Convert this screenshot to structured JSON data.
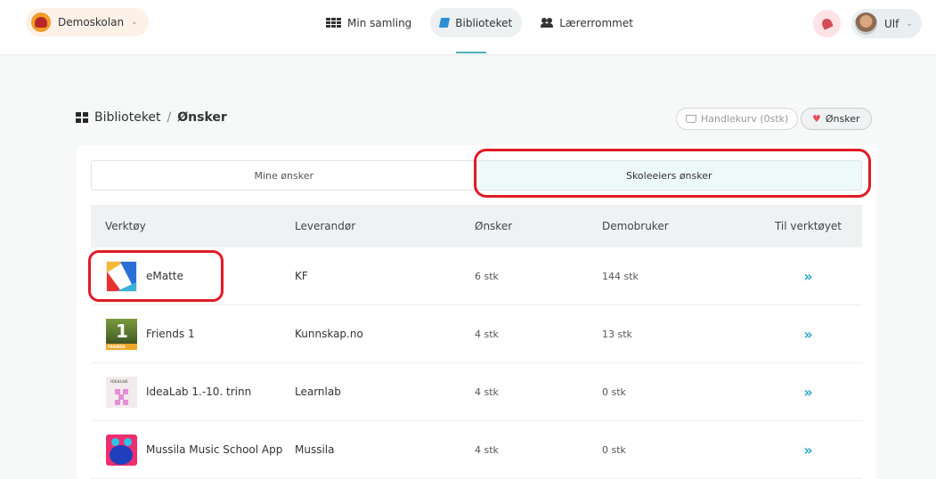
{
  "header": {
    "school_name": "Demoskolan",
    "nav": [
      {
        "label": "Min samling",
        "icon": "grid-icon"
      },
      {
        "label": "Biblioteket",
        "icon": "book-icon",
        "active": true
      },
      {
        "label": "Lærerrommet",
        "icon": "users-icon"
      }
    ],
    "user_name": "Ulf"
  },
  "breadcrumb": {
    "root": "Biblioteket",
    "separator": "/",
    "current": "Ønsker"
  },
  "actions": {
    "cart_label": "Handlekurv (0stk)",
    "wishes_label": "Ønsker"
  },
  "tabs": [
    {
      "label": "Mine ønsker",
      "active": false
    },
    {
      "label": "Skoleeiers ønsker",
      "active": true
    }
  ],
  "table": {
    "columns": [
      "Verktøy",
      "Leverandør",
      "Ønsker",
      "Demobruker",
      "Til verktøyet"
    ],
    "rows": [
      {
        "tool": "eMatte",
        "vendor": "KF",
        "wishes": "6 stk",
        "demo_users": "144 stk",
        "link": "»"
      },
      {
        "tool": "Friends 1",
        "vendor": "Kunnskap.no",
        "wishes": "4 stk",
        "demo_users": "13 stk",
        "link": "»"
      },
      {
        "tool": "IdeaLab 1.-10. trinn",
        "vendor": "Learnlab",
        "wishes": "4 stk",
        "demo_users": "0 stk",
        "link": "»"
      },
      {
        "tool": "Mussila Music School App",
        "vendor": "Mussila",
        "wishes": "4 stk",
        "demo_users": "0 stk",
        "link": "»"
      }
    ]
  },
  "thumb_text": {
    "friends_number": "1",
    "friends_word": "FRIENDS",
    "idealab_word": "IDEALAB"
  },
  "colors": {
    "accent": "#4db2b7",
    "link": "#2aa3c6",
    "heart": "#e4525c",
    "annotation": "#e01b24",
    "active_tab_bg": "#eef9fa"
  }
}
